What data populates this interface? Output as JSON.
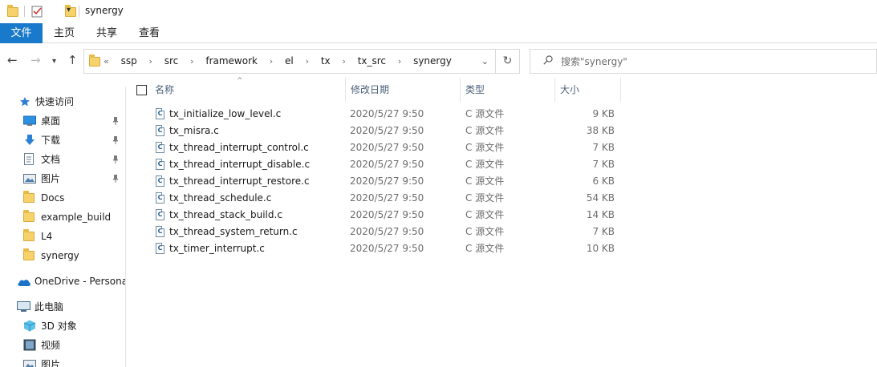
{
  "window": {
    "title": "synergy"
  },
  "ribbon": {
    "tabs": [
      "文件",
      "主页",
      "共享",
      "查看"
    ]
  },
  "address": {
    "overflow": "«",
    "crumbs": [
      "ssp",
      "src",
      "framework",
      "el",
      "tx",
      "tx_src",
      "synergy"
    ]
  },
  "search": {
    "placeholder": "搜索\"synergy\""
  },
  "sidebar": {
    "items": [
      {
        "label": "快速访问",
        "icon": "star-icon"
      },
      {
        "label": "桌面",
        "icon": "desktop-icon",
        "pinned": true
      },
      {
        "label": "下载",
        "icon": "download-icon",
        "pinned": true
      },
      {
        "label": "文档",
        "icon": "document-icon",
        "pinned": true
      },
      {
        "label": "图片",
        "icon": "pictures-icon",
        "pinned": true
      },
      {
        "label": "Docs",
        "icon": "folder-icon"
      },
      {
        "label": "example_build",
        "icon": "folder-icon"
      },
      {
        "label": "L4",
        "icon": "folder-icon"
      },
      {
        "label": "synergy",
        "icon": "folder-icon"
      },
      {
        "label": "OneDrive - Persona",
        "icon": "onedrive-icon"
      },
      {
        "label": "此电脑",
        "icon": "computer-icon"
      },
      {
        "label": "3D 对象",
        "icon": "3d-objects-icon"
      },
      {
        "label": "视频",
        "icon": "video-icon"
      },
      {
        "label": "图片",
        "icon": "pictures-icon"
      }
    ]
  },
  "columns": {
    "name": "名称",
    "date": "修改日期",
    "type": "类型",
    "size": "大小"
  },
  "files": [
    {
      "name": "tx_initialize_low_level.c",
      "date": "2020/5/27 9:50",
      "type": "C 源文件",
      "size": "9 KB"
    },
    {
      "name": "tx_misra.c",
      "date": "2020/5/27 9:50",
      "type": "C 源文件",
      "size": "38 KB"
    },
    {
      "name": "tx_thread_interrupt_control.c",
      "date": "2020/5/27 9:50",
      "type": "C 源文件",
      "size": "7 KB"
    },
    {
      "name": "tx_thread_interrupt_disable.c",
      "date": "2020/5/27 9:50",
      "type": "C 源文件",
      "size": "7 KB"
    },
    {
      "name": "tx_thread_interrupt_restore.c",
      "date": "2020/5/27 9:50",
      "type": "C 源文件",
      "size": "6 KB"
    },
    {
      "name": "tx_thread_schedule.c",
      "date": "2020/5/27 9:50",
      "type": "C 源文件",
      "size": "54 KB"
    },
    {
      "name": "tx_thread_stack_build.c",
      "date": "2020/5/27 9:50",
      "type": "C 源文件",
      "size": "14 KB"
    },
    {
      "name": "tx_thread_system_return.c",
      "date": "2020/5/27 9:50",
      "type": "C 源文件",
      "size": "7 KB"
    },
    {
      "name": "tx_timer_interrupt.c",
      "date": "2020/5/27 9:50",
      "type": "C 源文件",
      "size": "10 KB"
    }
  ],
  "colors": {
    "accent": "#1979ca",
    "folder": "#f6d26a",
    "header_text": "#4c607a"
  }
}
